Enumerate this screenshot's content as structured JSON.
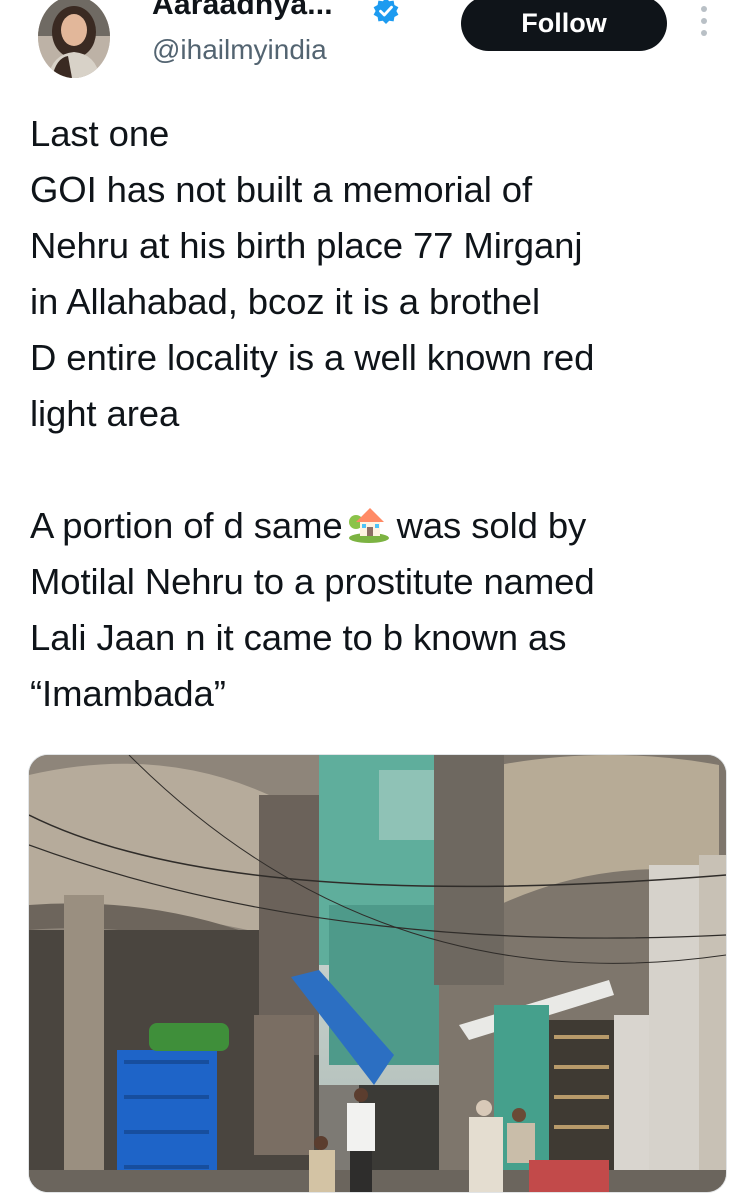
{
  "author": {
    "display_name": "Aaraadhya...",
    "handle": "@ihailmyindia",
    "verified": true,
    "verified_icon": "verified-badge-icon"
  },
  "actions": {
    "follow_label": "Follow",
    "more_icon": "more-vertical-icon"
  },
  "tweet": {
    "lines": [
      "Last one",
      "GOI has not built a memorial of",
      "Nehru at his birth place 77 Mirganj",
      "in Allahabad, bcoz it is a brothel",
      "D entire locality is a well known red",
      "light area"
    ],
    "para2_line1_before": "A portion of d same",
    "para2_emoji": "house-with-garden-emoji",
    "para2_line1_after": "was sold by",
    "para2_lines": [
      "Motilal Nehru to a prostitute named",
      "Lali Jaan n it came to b known as",
      "“Imambada”"
    ]
  },
  "colors": {
    "text": "#0f1419",
    "secondary": "#536471",
    "verified_blue": "#1d9bf0",
    "follow_bg": "#0f1419"
  }
}
